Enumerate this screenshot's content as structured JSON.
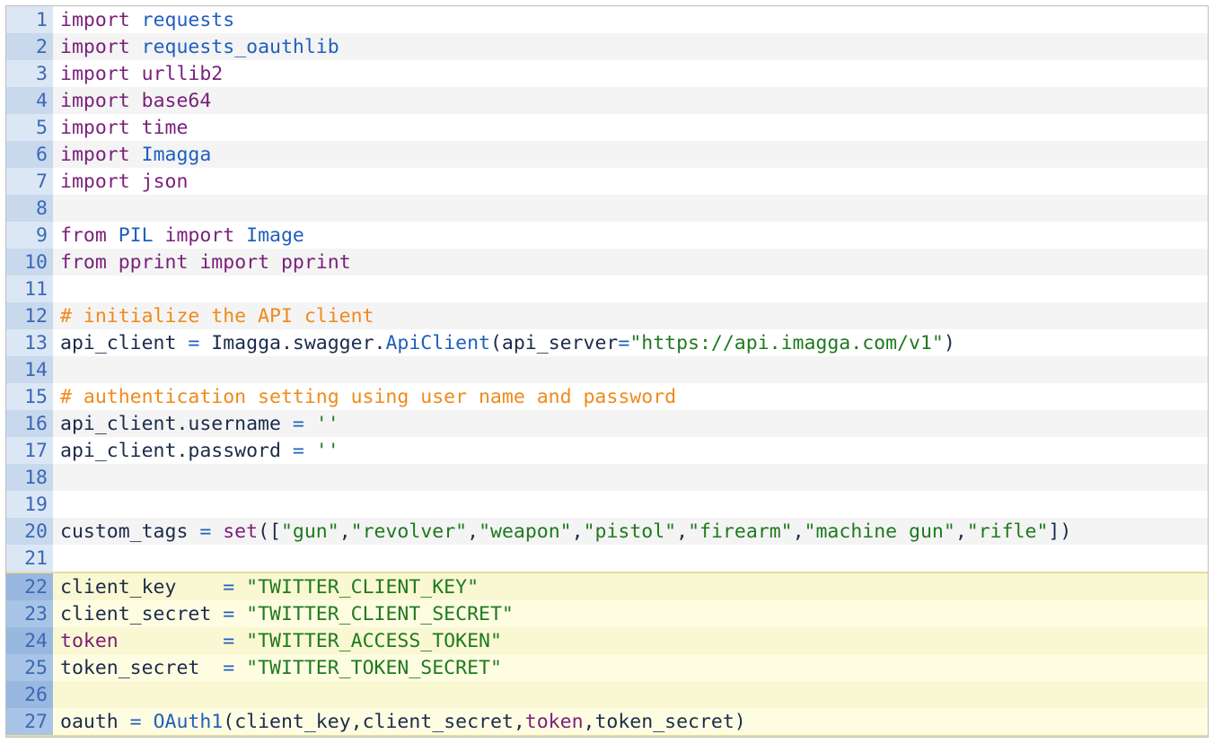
{
  "editor": {
    "lines": [
      {
        "no": "1",
        "tokens": [
          {
            "t": "import",
            "c": "kw"
          },
          {
            "t": " ",
            "c": "id"
          },
          {
            "t": "requests",
            "c": "mod"
          }
        ]
      },
      {
        "no": "2",
        "tokens": [
          {
            "t": "import",
            "c": "kw"
          },
          {
            "t": " ",
            "c": "id"
          },
          {
            "t": "requests_oauthlib",
            "c": "mod"
          }
        ]
      },
      {
        "no": "3",
        "tokens": [
          {
            "t": "import",
            "c": "kw"
          },
          {
            "t": " ",
            "c": "id"
          },
          {
            "t": "urllib2",
            "c": "fn"
          }
        ]
      },
      {
        "no": "4",
        "tokens": [
          {
            "t": "import",
            "c": "kw"
          },
          {
            "t": " ",
            "c": "id"
          },
          {
            "t": "base64",
            "c": "fn"
          }
        ]
      },
      {
        "no": "5",
        "tokens": [
          {
            "t": "import",
            "c": "kw"
          },
          {
            "t": " ",
            "c": "id"
          },
          {
            "t": "time",
            "c": "fn"
          }
        ]
      },
      {
        "no": "6",
        "tokens": [
          {
            "t": "import",
            "c": "kw"
          },
          {
            "t": " ",
            "c": "id"
          },
          {
            "t": "Imagga",
            "c": "cls"
          }
        ]
      },
      {
        "no": "7",
        "tokens": [
          {
            "t": "import",
            "c": "kw"
          },
          {
            "t": " ",
            "c": "id"
          },
          {
            "t": "json",
            "c": "fn"
          }
        ]
      },
      {
        "no": "8",
        "tokens": []
      },
      {
        "no": "9",
        "tokens": [
          {
            "t": "from",
            "c": "kw"
          },
          {
            "t": " ",
            "c": "id"
          },
          {
            "t": "PIL",
            "c": "cls"
          },
          {
            "t": " ",
            "c": "id"
          },
          {
            "t": "import",
            "c": "kw"
          },
          {
            "t": " ",
            "c": "id"
          },
          {
            "t": "Image",
            "c": "cls"
          }
        ]
      },
      {
        "no": "10",
        "tokens": [
          {
            "t": "from",
            "c": "kw"
          },
          {
            "t": " ",
            "c": "id"
          },
          {
            "t": "pprint",
            "c": "fn"
          },
          {
            "t": " ",
            "c": "id"
          },
          {
            "t": "import",
            "c": "kw"
          },
          {
            "t": " ",
            "c": "id"
          },
          {
            "t": "pprint",
            "c": "fn"
          }
        ]
      },
      {
        "no": "11",
        "tokens": []
      },
      {
        "no": "12",
        "tokens": [
          {
            "t": "# initialize the API client",
            "c": "cm"
          }
        ]
      },
      {
        "no": "13",
        "tokens": [
          {
            "t": "api_client",
            "c": "id"
          },
          {
            "t": " = ",
            "c": "op"
          },
          {
            "t": "Imagga.swagger.",
            "c": "id"
          },
          {
            "t": "ApiClient",
            "c": "cls"
          },
          {
            "t": "(api_server",
            "c": "id"
          },
          {
            "t": "=",
            "c": "op"
          },
          {
            "t": "\"https://api.imagga.com/v1\"",
            "c": "str"
          },
          {
            "t": ")",
            "c": "punct"
          }
        ]
      },
      {
        "no": "14",
        "tokens": []
      },
      {
        "no": "15",
        "tokens": [
          {
            "t": "# authentication setting using user name and password",
            "c": "cm"
          }
        ]
      },
      {
        "no": "16",
        "tokens": [
          {
            "t": "api_client.username",
            "c": "id"
          },
          {
            "t": " = ",
            "c": "op"
          },
          {
            "t": "''",
            "c": "str"
          }
        ]
      },
      {
        "no": "17",
        "tokens": [
          {
            "t": "api_client.password",
            "c": "id"
          },
          {
            "t": " = ",
            "c": "op"
          },
          {
            "t": "''",
            "c": "str"
          }
        ]
      },
      {
        "no": "18",
        "tokens": []
      },
      {
        "no": "19",
        "tokens": []
      },
      {
        "no": "20",
        "tokens": [
          {
            "t": "custom_tags",
            "c": "id"
          },
          {
            "t": " = ",
            "c": "op"
          },
          {
            "t": "set",
            "c": "fn"
          },
          {
            "t": "([",
            "c": "punct"
          },
          {
            "t": "\"gun\"",
            "c": "str"
          },
          {
            "t": ",",
            "c": "punct"
          },
          {
            "t": "\"revolver\"",
            "c": "str"
          },
          {
            "t": ",",
            "c": "punct"
          },
          {
            "t": "\"weapon\"",
            "c": "str"
          },
          {
            "t": ",",
            "c": "punct"
          },
          {
            "t": "\"pistol\"",
            "c": "str"
          },
          {
            "t": ",",
            "c": "punct"
          },
          {
            "t": "\"firearm\"",
            "c": "str"
          },
          {
            "t": ",",
            "c": "punct"
          },
          {
            "t": "\"machine gun\"",
            "c": "str"
          },
          {
            "t": ",",
            "c": "punct"
          },
          {
            "t": "\"rifle\"",
            "c": "str"
          },
          {
            "t": "])",
            "c": "punct"
          }
        ]
      },
      {
        "no": "21",
        "tokens": []
      },
      {
        "no": "22",
        "hl": true,
        "tokens": [
          {
            "t": "client_key",
            "c": "id"
          },
          {
            "t": "    = ",
            "c": "op"
          },
          {
            "t": "\"TWITTER_CLIENT_KEY\"",
            "c": "str"
          }
        ]
      },
      {
        "no": "23",
        "hl": true,
        "tokens": [
          {
            "t": "client_secret",
            "c": "id"
          },
          {
            "t": " = ",
            "c": "op"
          },
          {
            "t": "\"TWITTER_CLIENT_SECRET\"",
            "c": "str"
          }
        ]
      },
      {
        "no": "24",
        "hl": true,
        "tokens": [
          {
            "t": "token",
            "c": "fn"
          },
          {
            "t": "         = ",
            "c": "op"
          },
          {
            "t": "\"TWITTER_ACCESS_TOKEN\"",
            "c": "str"
          }
        ]
      },
      {
        "no": "25",
        "hl": true,
        "tokens": [
          {
            "t": "token_secret",
            "c": "id"
          },
          {
            "t": "  = ",
            "c": "op"
          },
          {
            "t": "\"TWITTER_TOKEN_SECRET\"",
            "c": "str"
          }
        ]
      },
      {
        "no": "26",
        "hl": true,
        "tokens": []
      },
      {
        "no": "27",
        "hl": true,
        "tokens": [
          {
            "t": "oauth",
            "c": "id"
          },
          {
            "t": " = ",
            "c": "op"
          },
          {
            "t": "OAuth1",
            "c": "cls"
          },
          {
            "t": "(client_key,client_secret,",
            "c": "id"
          },
          {
            "t": "token",
            "c": "fn"
          },
          {
            "t": ",token_secret)",
            "c": "id"
          }
        ]
      }
    ]
  },
  "colors": {
    "keyword": "#7a1f7a",
    "module": "#1f5fbf",
    "string": "#1e7a1e",
    "comment": "#f08a1a",
    "identifier": "#1b2b4b",
    "line_number": "#3c68b5",
    "highlight_bg": "#fefde2"
  }
}
